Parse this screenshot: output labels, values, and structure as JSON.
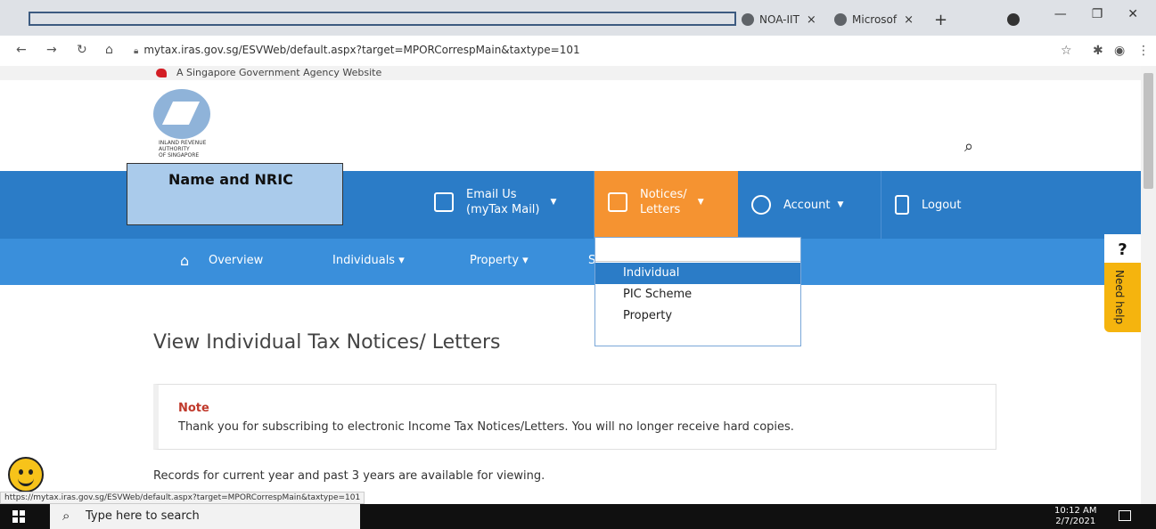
{
  "browser": {
    "tabs": [
      {
        "label": "NOA-IIT",
        "close": "×"
      },
      {
        "label": "Microsof",
        "close": "×"
      }
    ],
    "new_tab": "+",
    "window_controls": [
      "—",
      "❐",
      "✕"
    ],
    "url": "mytax.iras.gov.sg/ESVWeb/default.aspx?target=MPORCorrespMain&taxtype=101",
    "status_url": "https://mytax.iras.gov.sg/ESVWeb/default.aspx?target=MPORCorrespMain&taxtype=101"
  },
  "gov_banner": {
    "text": "A Singapore Government Agency Website"
  },
  "logo": {
    "lines": [
      "INLAND REVENUE",
      "AUTHORITY",
      "OF SINGAPORE"
    ]
  },
  "redaction_label": "Name and NRIC",
  "main_nav": {
    "email": {
      "line1": "Email Us",
      "line2": "(myTax Mail)"
    },
    "notices": {
      "line1": "Notices/",
      "line2": "Letters"
    },
    "account": "Account",
    "logout": "Logout"
  },
  "sub_nav": {
    "overview": "Overview",
    "individuals": "Individuals ▾",
    "property": "Property ▾",
    "truncated": "S"
  },
  "dropdown": {
    "items": [
      "Individual",
      "PIC Scheme",
      "Property"
    ]
  },
  "help": {
    "q": "?",
    "label": "Need help"
  },
  "page": {
    "title": "View Individual Tax Notices/ Letters",
    "note_label": "Note",
    "note_text": "Thank you for subscribing to electronic Income Tax Notices/Letters. You will no longer receive hard copies.",
    "records_text": "Records for current year and past 3 years are available for viewing."
  },
  "taskbar": {
    "search_placeholder": "Type here to search",
    "time": "10:12 AM",
    "date": "2/7/2021"
  },
  "colors": {
    "nav_blue": "#2b7cc7",
    "notices_orange": "#f59331",
    "help_yellow": "#f5b40e",
    "note_red": "#c0392b"
  }
}
